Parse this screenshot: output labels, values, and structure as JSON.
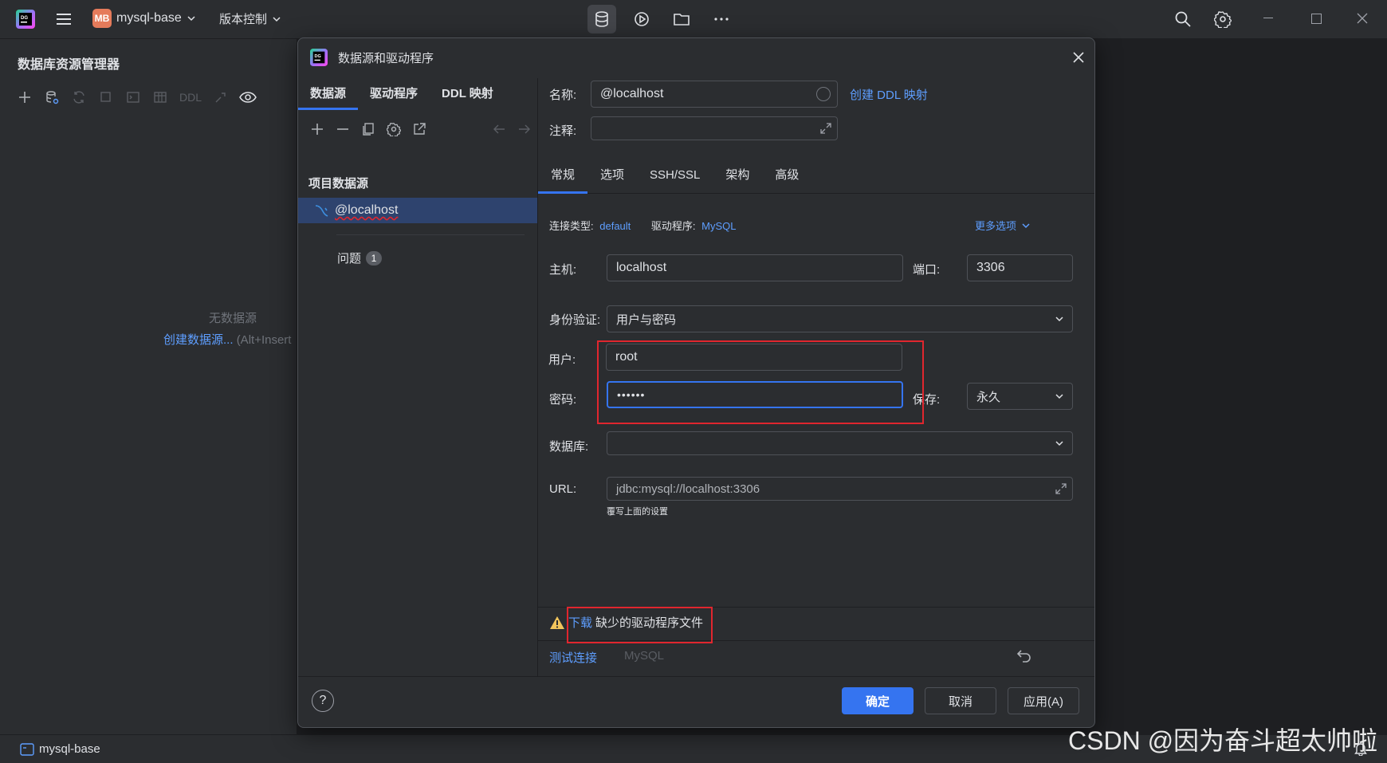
{
  "titlebar": {
    "project_initials": "MB",
    "project_name": "mysql-base",
    "vcs_menu": "版本控制"
  },
  "left_panel": {
    "title": "数据库资源管理器",
    "ddl_label": "DDL",
    "empty_text": "无数据源",
    "create_link": "创建数据源...",
    "create_shortcut": "(Alt+Insert"
  },
  "dialog": {
    "title": "数据源和驱动程序",
    "tabs": [
      "数据源",
      "驱动程序",
      "DDL 映射"
    ],
    "section_title": "项目数据源",
    "selected_source": "@localhost",
    "problems_label": "问题",
    "problems_count": "1",
    "name_label": "名称:",
    "name_value": "@localhost",
    "create_ddl_link": "创建 DDL 映射",
    "comment_label": "注释:",
    "comment_value": "",
    "subtabs": [
      "常规",
      "选项",
      "SSH/SSL",
      "架构",
      "高级"
    ],
    "conn_type_label": "连接类型:",
    "conn_type_value": "default",
    "driver_label": "驱动程序:",
    "driver_value": "MySQL",
    "more_options": "更多选项",
    "host_label": "主机:",
    "host_value": "localhost",
    "port_label": "端口:",
    "port_value": "3306",
    "auth_label": "身份验证:",
    "auth_value": "用户与密码",
    "user_label": "用户:",
    "user_value": "root",
    "password_label": "密码:",
    "password_value": "••••••",
    "save_label": "保存:",
    "save_value": "永久",
    "database_label": "数据库:",
    "database_value": "",
    "url_label": "URL:",
    "url_value": "jdbc:mysql://localhost:3306",
    "url_hint": "覆写上面的设置",
    "warning_link": "下载",
    "warning_text": "缺少的驱动程序文件",
    "test_connection": "测试连接",
    "test_driver": "MySQL",
    "ok_button": "确定",
    "cancel_button": "取消",
    "apply_button": "应用(A)"
  },
  "statusbar": {
    "project": "mysql-base"
  },
  "watermark": "CSDN @因为奋斗超太帅啦",
  "colors": {
    "accent": "#3574f0",
    "link": "#5e9eff",
    "background": "#2b2d30",
    "highlight_box": "#e0262e",
    "warning": "#f2c55c"
  }
}
